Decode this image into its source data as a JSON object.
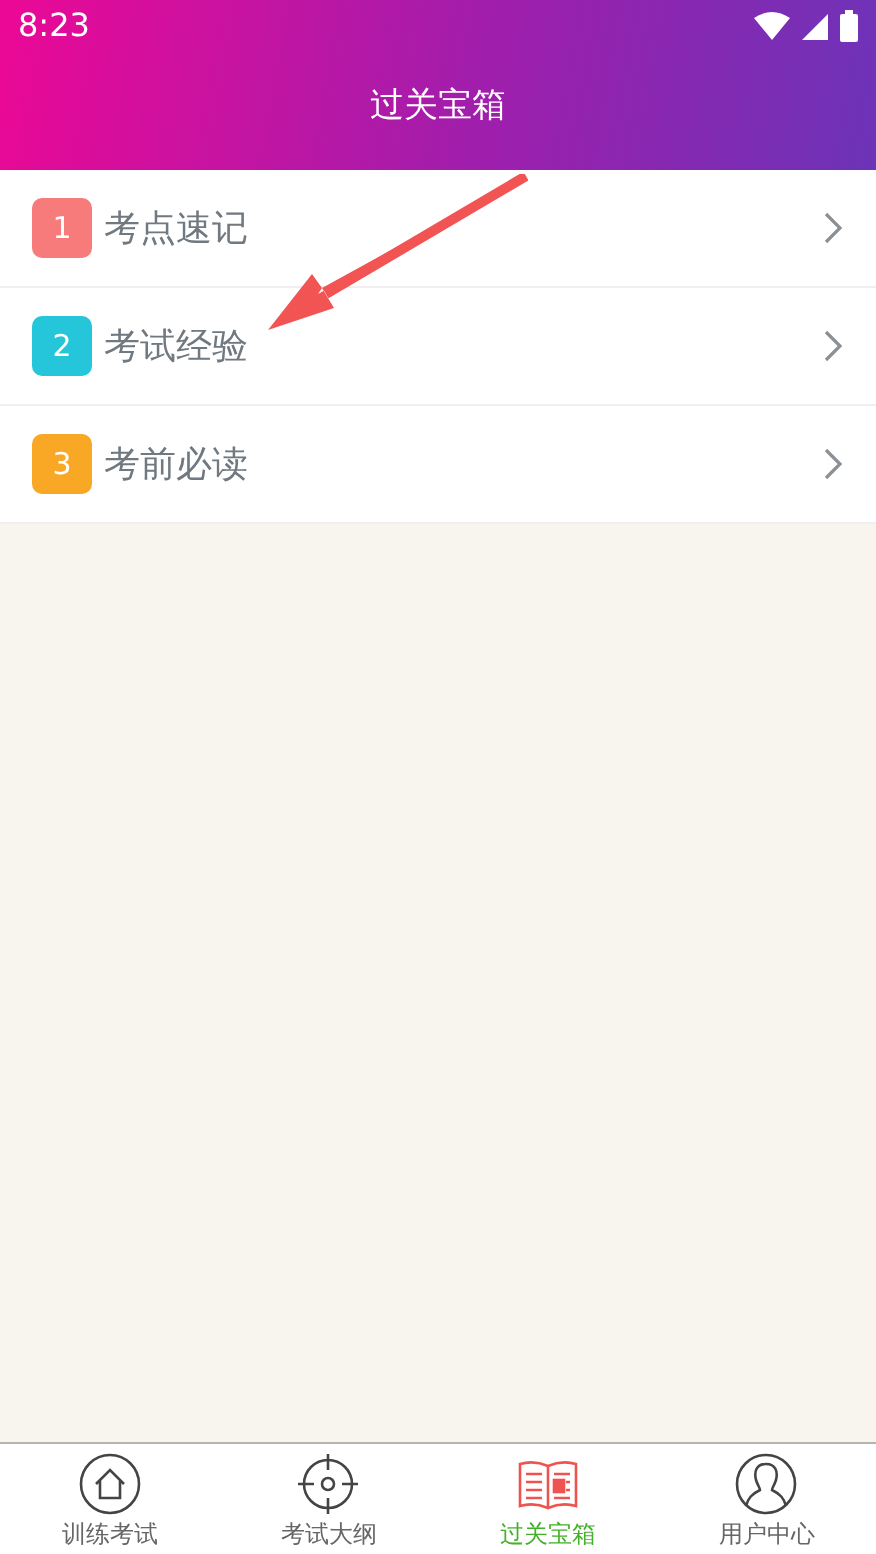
{
  "status_bar": {
    "time": "8:23"
  },
  "header": {
    "title": "过关宝箱"
  },
  "items": [
    {
      "number": "1",
      "label": "考点速记",
      "color": "#f77b7b"
    },
    {
      "number": "2",
      "label": "考试经验",
      "color": "#26c6da"
    },
    {
      "number": "3",
      "label": "考前必读",
      "color": "#f9a825"
    }
  ],
  "bottom_nav": [
    {
      "label": "训练考试",
      "selected": false
    },
    {
      "label": "考试大纲",
      "selected": false
    },
    {
      "label": "过关宝箱",
      "selected": true
    },
    {
      "label": "用户中心",
      "selected": false
    }
  ]
}
